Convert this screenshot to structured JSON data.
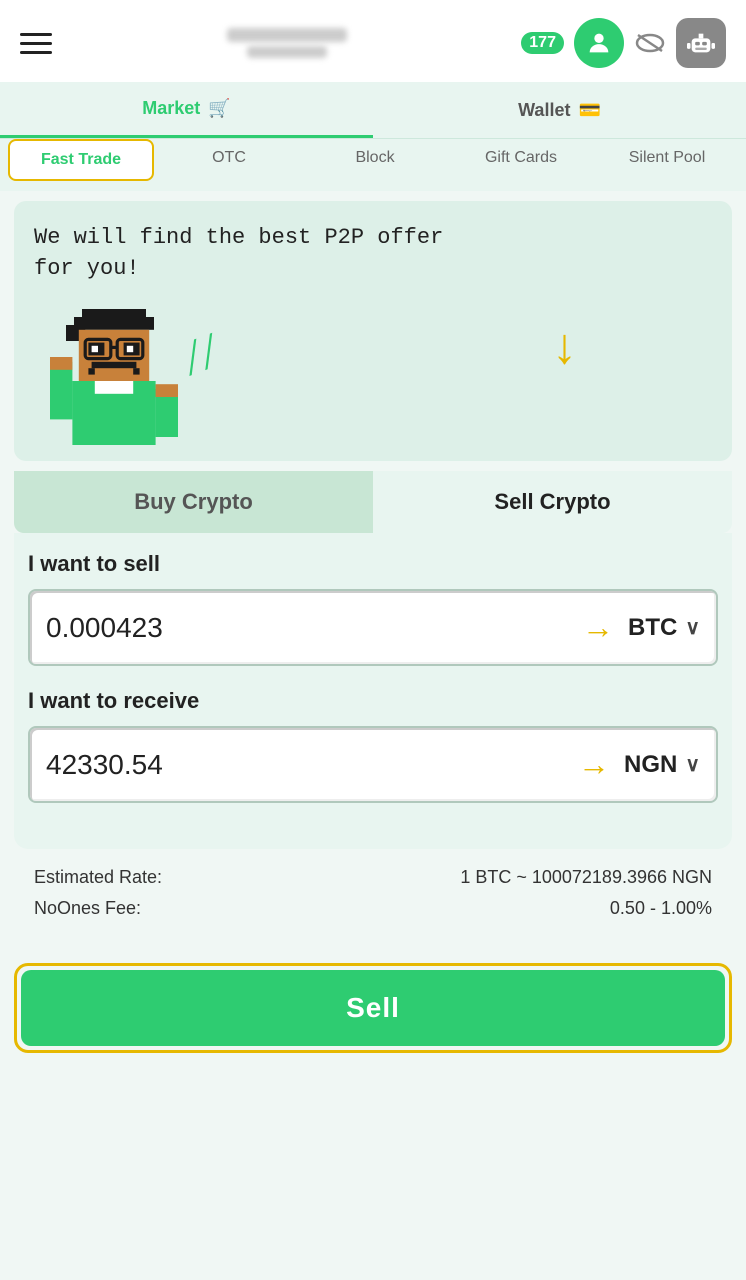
{
  "header": {
    "notification_count": "177",
    "hamburger_label": "Menu"
  },
  "nav": {
    "tabs": [
      {
        "id": "market",
        "label": "Market",
        "icon": "🛒",
        "active": true
      },
      {
        "id": "wallet",
        "label": "Wallet",
        "icon": "💳",
        "active": false
      }
    ],
    "sub_tabs": [
      {
        "id": "fast-trade",
        "label": "Fast Trade",
        "active": true
      },
      {
        "id": "otc",
        "label": "OTC",
        "active": false
      },
      {
        "id": "block",
        "label": "Block",
        "active": false
      },
      {
        "id": "gift-cards",
        "label": "Gift Cards",
        "active": false
      },
      {
        "id": "silent-pool",
        "label": "Silent Pool",
        "active": false
      }
    ]
  },
  "banner": {
    "text": "We will find the best P2P offer for you!"
  },
  "toggle": {
    "buy_label": "Buy Crypto",
    "sell_label": "Sell Crypto",
    "active": "sell"
  },
  "sell_form": {
    "sell_label": "I want to sell",
    "sell_amount": "0.000423",
    "sell_currency": "BTC",
    "receive_label": "I want to receive",
    "receive_amount": "42330.54",
    "receive_currency": "NGN"
  },
  "rate_info": {
    "estimated_rate_label": "Estimated Rate:",
    "estimated_rate_value": "1 BTC ~ 100072189.3966 NGN",
    "fee_label": "NoOnes Fee:",
    "fee_value": "0.50 - 1.00%"
  },
  "sell_button": {
    "label": "Sell"
  }
}
